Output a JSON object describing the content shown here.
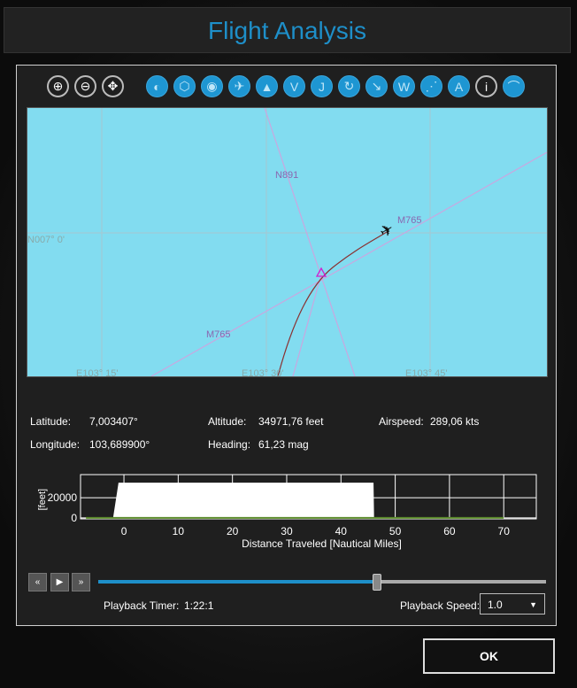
{
  "title": "Flight Analysis",
  "toolbar": {
    "zoom_buttons": [
      {
        "icon": "zoom-in-icon"
      },
      {
        "icon": "zoom-out-icon"
      },
      {
        "icon": "center-icon"
      }
    ],
    "layer_buttons": [
      {
        "icon": "airspace-icon",
        "glyph": "◐"
      },
      {
        "icon": "vor-icon",
        "glyph": "⬡"
      },
      {
        "icon": "ndb-icon",
        "glyph": "◉"
      },
      {
        "icon": "airport-icon",
        "glyph": "✈"
      },
      {
        "icon": "waypoint-icon",
        "glyph": "▲"
      },
      {
        "icon": "victor-airway-icon",
        "glyph": "V"
      },
      {
        "icon": "jet-airway-icon",
        "glyph": "J"
      },
      {
        "icon": "holding-icon",
        "glyph": "↻"
      },
      {
        "icon": "route-icon",
        "glyph": "↘"
      },
      {
        "icon": "weather-icon",
        "glyph": "W"
      },
      {
        "icon": "track-icon",
        "glyph": "⋰"
      },
      {
        "icon": "altitude-icon",
        "glyph": "A"
      },
      {
        "icon": "info-icon",
        "glyph": "i"
      },
      {
        "icon": "terrain-icon",
        "glyph": "⌒"
      }
    ]
  },
  "map": {
    "background": "#82dcf0",
    "labels": {
      "lat": "N007° 0'",
      "lon1": "E103° 15'",
      "lon2": "E103° 30'",
      "lon3": "E103° 45'",
      "airway1": "N891",
      "airway2": "M765",
      "airway3": "M765"
    }
  },
  "info": {
    "latitude_label": "Latitude:",
    "latitude": "7,003407°",
    "longitude_label": "Longitude:",
    "longitude": "103,689900°",
    "altitude_label": "Altitude:",
    "altitude": "34971,76 feet",
    "heading_label": "Heading:",
    "heading": "61,23 mag",
    "airspeed_label": "Airspeed:",
    "airspeed": "289,06 kts"
  },
  "chart_data": {
    "type": "area",
    "xlabel": "Distance Traveled [Nautical Miles]",
    "ylabel": "[feet]",
    "xlim": [
      -8,
      76
    ],
    "ylim": [
      -1000,
      43000
    ],
    "xticks": [
      0,
      10,
      20,
      30,
      40,
      50,
      60,
      70
    ],
    "yticks": [
      0,
      20000
    ],
    "grid": true,
    "series": [
      {
        "values_x": [
          -2,
          -1,
          0,
          46,
          46.1
        ],
        "values_y": [
          0,
          35000,
          35000,
          35000,
          0
        ],
        "color": "#ffffff"
      },
      {
        "values_x": [
          -7,
          70
        ],
        "values_y": [
          0,
          0
        ],
        "color": "#5a8a2a"
      }
    ]
  },
  "playback": {
    "progress": 0.62,
    "timer_label": "Playback Timer:",
    "timer": "1:22:1",
    "speed_label": "Playback Speed:",
    "speed": "1.0"
  },
  "ok_label": "OK"
}
